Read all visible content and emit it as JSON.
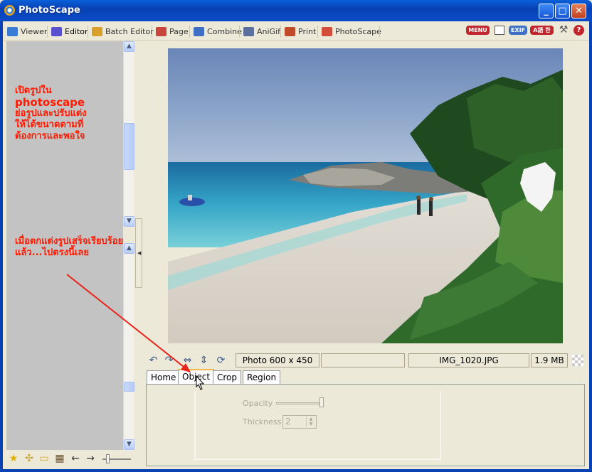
{
  "window": {
    "title": "PhotoScape",
    "buttons": {
      "minimize": "_",
      "maximize": "□",
      "close": "✕"
    }
  },
  "tabs": [
    {
      "label": "Viewer",
      "icon": "viewer-icon",
      "color": "#3a7bd5"
    },
    {
      "label": "Editor",
      "icon": "editor-icon",
      "color": "#5a4fcf",
      "active": true
    },
    {
      "label": "Batch Editor",
      "icon": "batch-editor-icon",
      "color": "#d9a02b"
    },
    {
      "label": "Page",
      "icon": "page-icon",
      "color": "#c8453c"
    },
    {
      "label": "Combine",
      "icon": "combine-icon",
      "color": "#3f6fc4"
    },
    {
      "label": "AniGif",
      "icon": "anigif-icon",
      "color": "#5b6f9c"
    },
    {
      "label": "Print",
      "icon": "print-icon",
      "color": "#c14a2a"
    },
    {
      "label": "PhotoScape",
      "icon": "photoscape-icon",
      "color": "#d34d3b"
    }
  ],
  "right_tools": {
    "menu_label": "MENU",
    "exif_label": "EXIF",
    "lang_label": "A語 한"
  },
  "sidebar": {
    "annotation_1": [
      "เปิดรูปใน",
      "photoscape",
      "ย่อรูปและปรับแต่ง",
      "ให้ได้ขนาดตามที่",
      "ต้องการและพอใจ"
    ],
    "annotation_2": [
      "เมื่อตกแต่งรูปเสร็จเรียบร้อย",
      "แล้ว...ไปตรงนี้เลย"
    ]
  },
  "status": {
    "photo_size": "Photo 600 x 450",
    "filename": "IMG_1020.JPG",
    "filesize": "1.9 MB"
  },
  "panel_tabs": [
    {
      "label": "Home"
    },
    {
      "label": "Object",
      "active": true
    },
    {
      "label": "Crop"
    },
    {
      "label": "Region"
    }
  ],
  "panel": {
    "opacity_label": "Opacity",
    "opacity": 1.0,
    "thickness_label": "Thickness",
    "thickness_value": "2"
  },
  "colors": {
    "annotation": "#ff1a00",
    "titlebar": "#0a4cc8",
    "sidebar_bg": "#c3c3c3"
  }
}
